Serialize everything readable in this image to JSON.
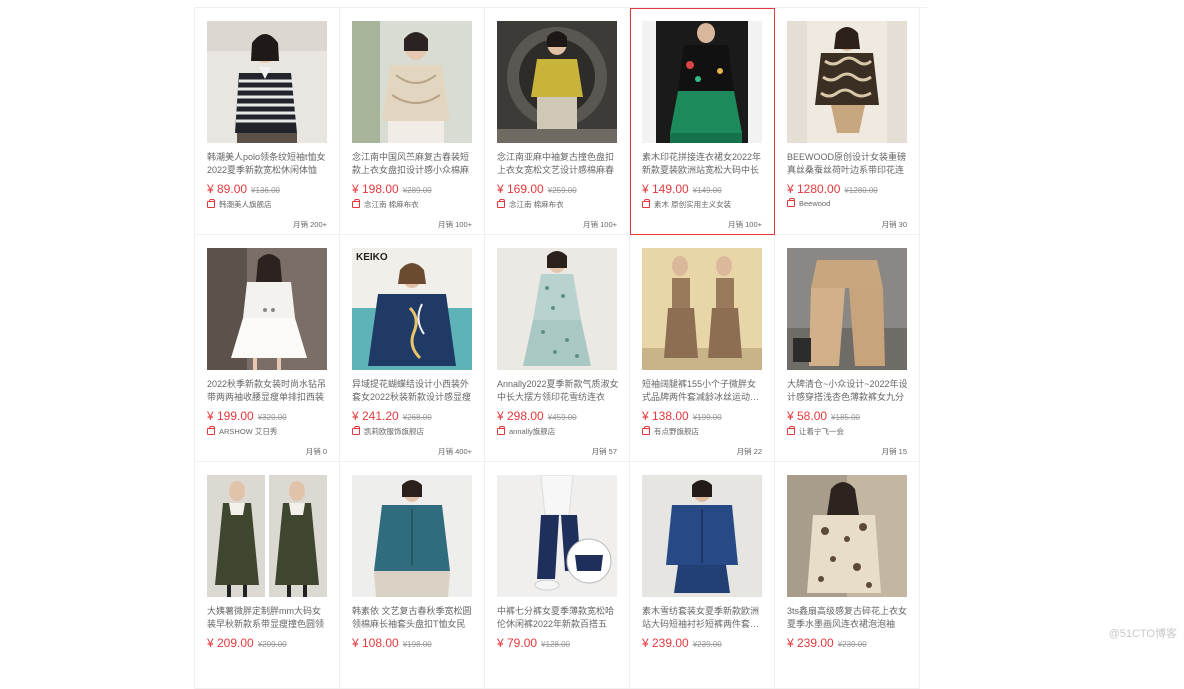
{
  "products": [
    {
      "title": "韩潮美人polo领条纹短袖t恤女2022夏季新款宽松休闲体恤",
      "price": "¥ 89.00",
      "original_price": "¥136.00",
      "shop": "韩潮美人旗舰店",
      "sales": "月销 200+",
      "image": "striped-polo-shirt"
    },
    {
      "title": "念江南中国风苎麻复古春装短款上衣女盘扣设计感小众棉麻",
      "price": "¥ 198.00",
      "original_price": "¥289.00",
      "shop": "念江南 棉麻布衣",
      "sales": "月销 100+",
      "image": "linen-chinese-top"
    },
    {
      "title": "念江南亚麻中袖复古撞色盘扣上衣女宽松文艺设计感棉麻春",
      "price": "¥ 169.00",
      "original_price": "¥259.00",
      "shop": "念江南 棉麻布衣",
      "sales": "月销 100+",
      "image": "yellow-linen-blouse"
    },
    {
      "title": "素木印花拼接连衣裙女2022年新款夏装欧洲站宽松大码中长",
      "price": "¥ 149.00",
      "original_price": "¥149.00",
      "shop": "素木 原创实用主义女装",
      "sales": "月销 100+",
      "image": "black-green-dress",
      "selected": true
    },
    {
      "title": "BEEWOOD原创设计女装重磅真丝桑蚕丝荷叶边系带印花连",
      "price": "¥ 1280.00",
      "original_price": "¥1280.00",
      "shop": "Beewood",
      "sales": "月销 30",
      "image": "silk-print-dress"
    },
    {
      "title": "2022秋季新款女装时尚水钻吊带两两袖收腰显瘦单排扣西装",
      "price": "¥ 199.00",
      "original_price": "¥320.00",
      "shop": "ARSHOW 艾日秀",
      "sales": "月销 0",
      "image": "white-blazer-dress"
    },
    {
      "title": "异域提花蝴蝶结设计小西装外套女2022秋装新款设计感显瘦",
      "price": "¥ 241.20",
      "original_price": "¥268.00",
      "shop": "凯莉欧服饰旗舰店",
      "sales": "月销 400+",
      "image": "navy-embroidered-jacket",
      "brand_text": "KEIKO"
    },
    {
      "title": "Annally2022夏季新款气质淑女中长大摆方领印花雪纺连衣",
      "price": "¥ 298.00",
      "original_price": "¥459.00",
      "shop": "annally旗舰店",
      "sales": "月销 57",
      "image": "floral-chiffon-dress"
    },
    {
      "title": "短袖阔腿裤155小个子微胖女式品牌两件套减龄冰丝运动休闲",
      "price": "¥ 138.00",
      "original_price": "¥199.00",
      "shop": "有点野旗舰店",
      "sales": "月销 22",
      "image": "khaki-two-piece-set"
    },
    {
      "title": "大牌清仓~小众设计~2022年设计感穿搭浅杏色薄款裤女九分",
      "price": "¥ 58.00",
      "original_price": "¥185.00",
      "shop": "让着宁飞一会",
      "sales": "月销 15",
      "image": "beige-wide-pants"
    },
    {
      "title": "大姨薯微胖定制胖mm大码女装早秋新款系带显瘦撞色圆领",
      "price": "¥ 209.00",
      "original_price": "¥209.00",
      "shop": "",
      "sales": "",
      "image": "olive-pinafore-dress"
    },
    {
      "title": "韩素依 文艺复古春秋季宽松圆领棉麻长袖套头盘扣T恤女民",
      "price": "¥ 108.00",
      "original_price": "¥198.00",
      "shop": "",
      "sales": "",
      "image": "teal-linen-top"
    },
    {
      "title": "中裤七分裤女夏季薄款宽松哈伦休闲裤2022年新款百搭五",
      "price": "¥ 79.00",
      "original_price": "¥128.00",
      "shop": "",
      "sales": "",
      "image": "navy-cropped-pants"
    },
    {
      "title": "素木雪纺套装女夏季新款欧洲站大码短袖衬衫短裤两件套2022",
      "price": "¥ 239.00",
      "original_price": "¥239.00",
      "shop": "",
      "sales": "",
      "image": "navy-shirt-shorts-set"
    },
    {
      "title": "3ts鑫扇高级感复古碎花上衣女夏季水墨画风连衣裙泡泡袖",
      "price": "¥ 239.00",
      "original_price": "¥239.00",
      "shop": "",
      "sales": "",
      "image": "floral-puff-sleeve-top"
    }
  ],
  "watermark": "@51CTO博客",
  "colors": {
    "accent": "#e4393c",
    "border": "#f0f0f0",
    "text": "#666666"
  }
}
